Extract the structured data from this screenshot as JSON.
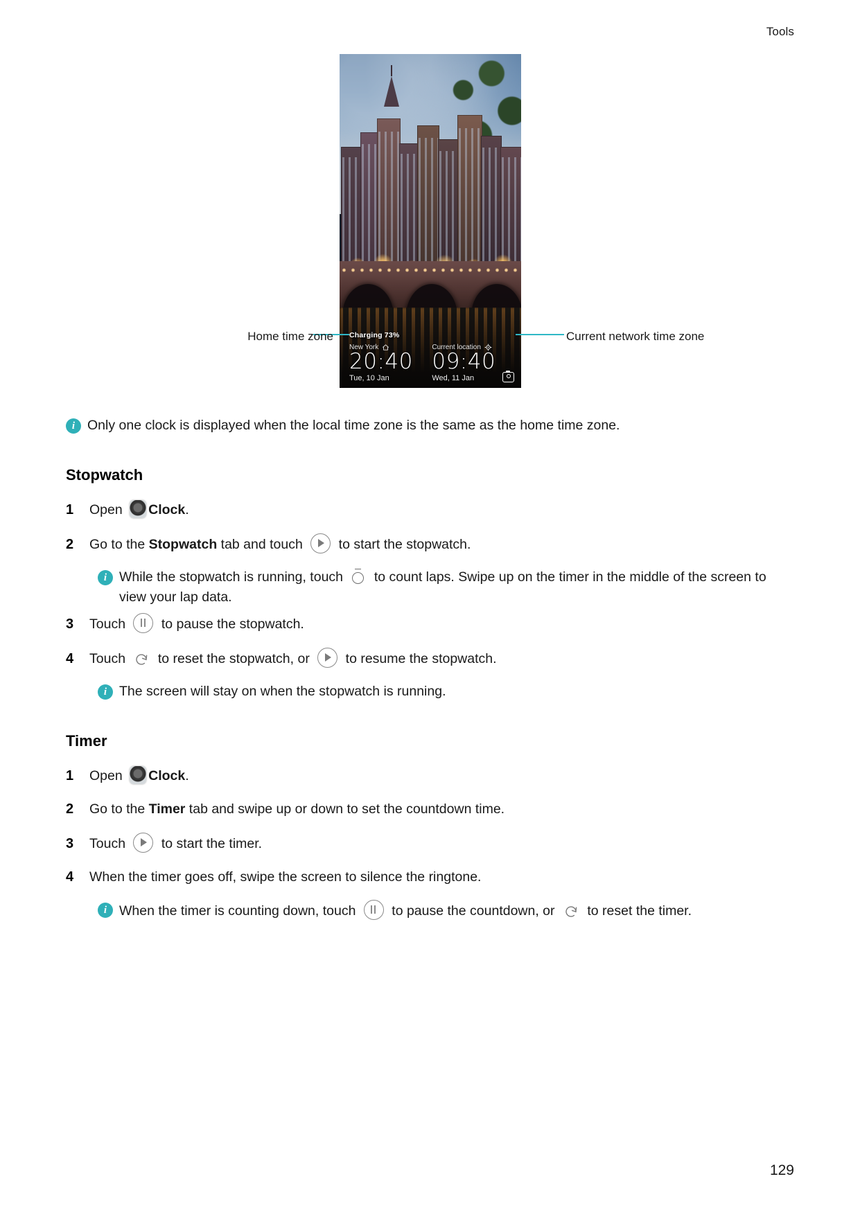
{
  "header": {
    "running_head": "Tools"
  },
  "footer": {
    "page_number": "129"
  },
  "figure": {
    "callout_left": "Home time zone",
    "callout_right": "Current network time zone",
    "leader_color": "#2fb8c6",
    "lockscreen": {
      "charging_status": "Charging 73%",
      "home_clock": {
        "zone_label": "New York",
        "zone_icon": "home-icon",
        "time": "20:40",
        "date": "Tue, 10 Jan"
      },
      "network_clock": {
        "zone_label": "Current location",
        "zone_icon": "location-icon",
        "time": "09:40",
        "date": "Wed, 11 Jan"
      },
      "camera_shortcut_icon": "camera-icon"
    }
  },
  "intro_note": {
    "icon": "info-icon",
    "text": "Only one clock is displayed when the local time zone is the same as the home time zone."
  },
  "stopwatch": {
    "heading": "Stopwatch",
    "steps": [
      {
        "num": "1",
        "pre": "Open ",
        "icon": "clock-app-icon",
        "bold": "Clock",
        "post": "."
      },
      {
        "num": "2",
        "pre": "Go to the ",
        "bold": "Stopwatch",
        "mid": " tab and touch ",
        "icon": "play-icon",
        "post": " to start the stopwatch."
      },
      {
        "num": "3",
        "pre": "Touch ",
        "icon": "pause-icon",
        "post": " to pause the stopwatch."
      },
      {
        "num": "4",
        "pre": "Touch ",
        "icon": "reset-icon",
        "mid": " to reset the stopwatch, or ",
        "icon2": "play-icon",
        "post": " to resume the stopwatch."
      }
    ],
    "note_lap": {
      "icon": "info-icon",
      "pre": "While the stopwatch is running, touch ",
      "icon_inline": "lap-icon",
      "post": " to count laps. Swipe up on the timer in the middle of the screen to view your lap data."
    },
    "note_screen": {
      "icon": "info-icon",
      "text": "The screen will stay on when the stopwatch is running."
    }
  },
  "timer": {
    "heading": "Timer",
    "steps": [
      {
        "num": "1",
        "pre": "Open ",
        "icon": "clock-app-icon",
        "bold": "Clock",
        "post": "."
      },
      {
        "num": "2",
        "pre": "Go to the ",
        "bold": "Timer",
        "mid": " tab and swipe up or down to set the countdown time.",
        "post": ""
      },
      {
        "num": "3",
        "pre": "Touch ",
        "icon": "play-icon",
        "post": " to start the timer."
      },
      {
        "num": "4",
        "pre": "When the timer goes off, swipe the screen to silence the ringtone.",
        "post": ""
      }
    ],
    "note_countdown": {
      "icon": "info-icon",
      "pre": "When the timer is counting down, touch ",
      "icon_inline": "pause-icon",
      "mid": " to pause the countdown, or ",
      "icon_inline2": "reset-icon",
      "post": " to reset the timer."
    }
  }
}
